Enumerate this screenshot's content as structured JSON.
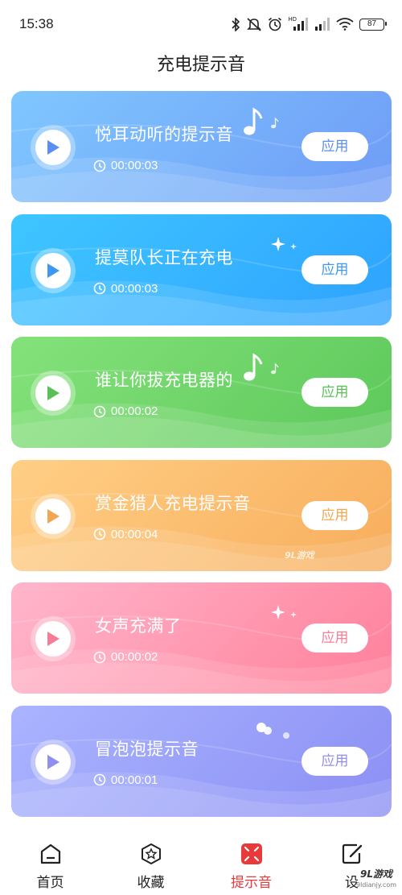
{
  "status": {
    "time": "15:38",
    "battery": "87",
    "hd_label": "HD"
  },
  "header": {
    "title": "充电提示音"
  },
  "sounds": [
    {
      "title": "悦耳动听的提示音",
      "duration": "00:00:03",
      "apply_label": "应用",
      "colors": {
        "from": "#7fc7ff",
        "to": "#6f9bf6",
        "accent": "#5b8ef5"
      },
      "decoration": "music-notes-icon"
    },
    {
      "title": "提莫队长正在充电",
      "duration": "00:00:03",
      "apply_label": "应用",
      "colors": {
        "from": "#3fc6ff",
        "to": "#2ea2ff",
        "accent": "#3b98f5"
      },
      "decoration": "sparkle-icon"
    },
    {
      "title": "谁让你拔充电器的",
      "duration": "00:00:02",
      "apply_label": "应用",
      "colors": {
        "from": "#85e27b",
        "to": "#5cc85a",
        "accent": "#58c156"
      },
      "decoration": "music-notes-icon"
    },
    {
      "title": "赏金猎人充电提示音",
      "duration": "00:00:04",
      "apply_label": "应用",
      "colors": {
        "from": "#ffcf86",
        "to": "#f8ad5c",
        "accent": "#f1a652"
      },
      "decoration": "none"
    },
    {
      "title": "女声充满了",
      "duration": "00:00:02",
      "apply_label": "应用",
      "colors": {
        "from": "#ffb6cc",
        "to": "#ff7f99",
        "accent": "#f77d96"
      },
      "decoration": "sparkle-icon"
    },
    {
      "title": "冒泡泡提示音",
      "duration": "00:00:01",
      "apply_label": "应用",
      "colors": {
        "from": "#aab4ff",
        "to": "#8b8ff4",
        "accent": "#8e8ff0"
      },
      "decoration": "bubbles-icon"
    }
  ],
  "watermark_mid": "9L游戏",
  "tabs": [
    {
      "label": "首页",
      "icon": "home-icon",
      "active": false
    },
    {
      "label": "收藏",
      "icon": "star-icon",
      "active": false
    },
    {
      "label": "提示音",
      "icon": "bell-icon",
      "active": true
    },
    {
      "label": "设",
      "icon": "settings-edit-icon",
      "active": false
    }
  ],
  "watermark_corner": {
    "logo": "9L游戏",
    "url": "9ldianjy.com"
  },
  "theme": {
    "active_tab": "#e83a3a",
    "text": "#222222"
  }
}
